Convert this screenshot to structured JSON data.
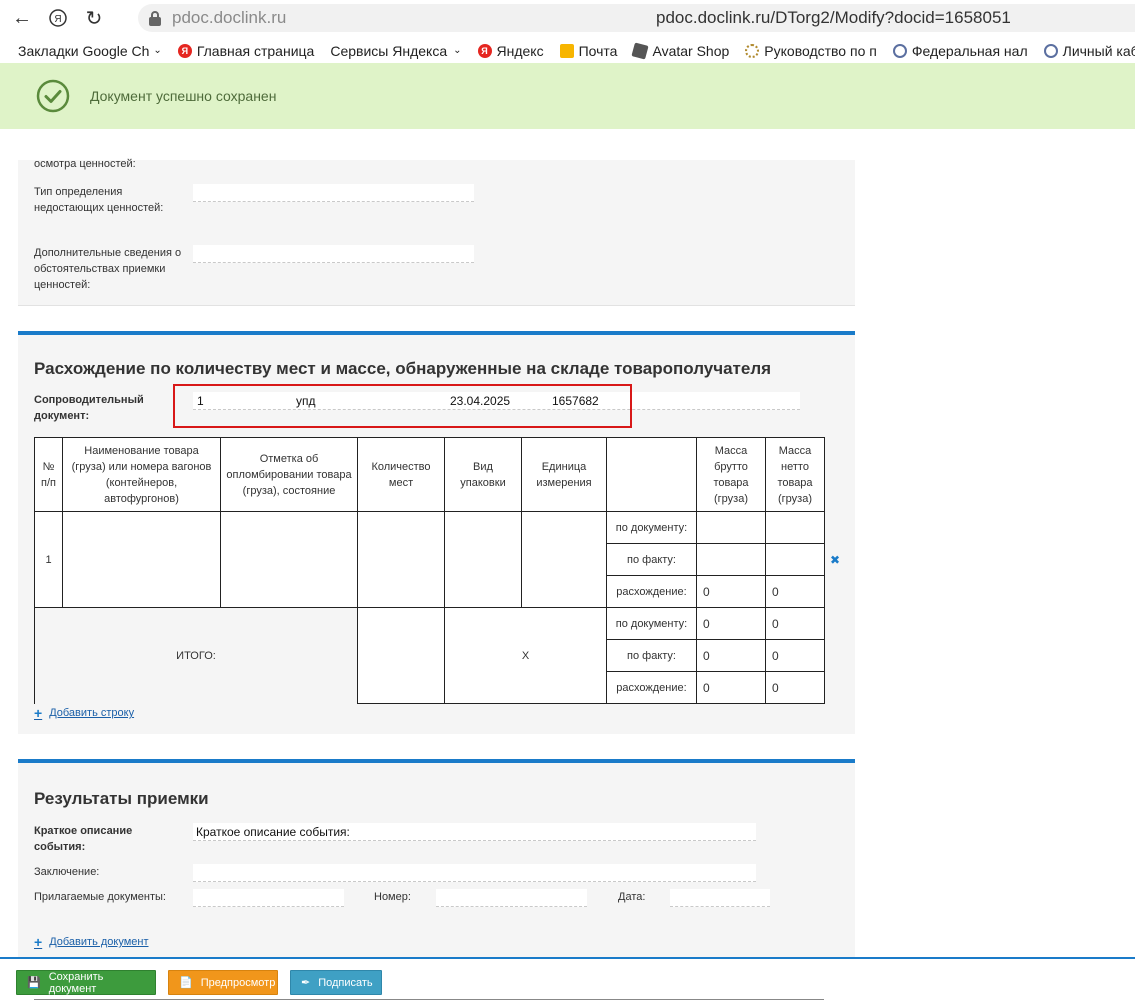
{
  "browser": {
    "domain": "pdoc.doclink.ru",
    "url": "pdoc.doclink.ru/DTorg2/Modify?docid=1658051",
    "bookmarks": [
      "Закладки Google Ch",
      "Главная страница",
      "Сервисы Яндекса",
      "Яндекс",
      "Почта",
      "Avatar Shop",
      "Руководство по п",
      "Федеральная нал",
      "Личный кабинет"
    ]
  },
  "alert": {
    "message": "Документ успешно сохранен"
  },
  "section1": {
    "cut_label": "осмотра ценностей:",
    "type_label": "Тип определения недостающих ценностей:",
    "extra_label": "Дополнительные сведения о обстоятельствах приемки ценностей:"
  },
  "section2": {
    "title": "Расхождение по количеству мест и массе, обнаруженные на складе товарополучателя",
    "doc_label": "Сопроводительный документ:",
    "doc_number": "1",
    "doc_type": "упд",
    "doc_date": "23.04.2025",
    "doc_id": "1657682",
    "columns": [
      "№ п/п",
      "Наименование товара (груза) или номера вагонов (контейнеров, автофургонов)",
      "Отметка об опломбировании товара (груза), состояние",
      "Количество мест",
      "Вид упаковки",
      "Единица измерения",
      "Масса брутто товара (груза)",
      "Масса нетто товара (груза)"
    ],
    "row_index": "1",
    "by_doc": "по документу:",
    "by_fact": "по факту:",
    "diff": "расхождение:",
    "zero": "0",
    "total_label": "ИТОГО:",
    "total_x": "X",
    "add_row": "Добавить строку"
  },
  "section3": {
    "title": "Результаты приемки",
    "short_label": "Краткое описание события:",
    "short_value": "Краткое описание события:",
    "conclusion_label": "Заключение:",
    "attached_label": "Прилагаемые документы:",
    "number_label": "Номер:",
    "date_label": "Дата:",
    "add_doc": "Добавить документ"
  },
  "buttons": {
    "save": "Сохранить документ",
    "preview": "Предпросмотр",
    "sign": "Подписать"
  },
  "colors": {
    "accent": "#1a7bc9",
    "success_bg": "#dff3c8",
    "save": "#3d9b3d",
    "preview": "#f1961b",
    "sign": "#3fa0c4"
  }
}
